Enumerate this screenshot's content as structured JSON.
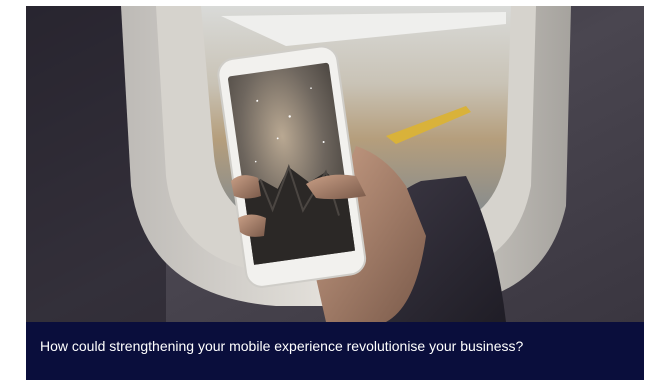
{
  "card": {
    "caption": "How could strengthening your mobile experience revolutionise your business?"
  },
  "image": {
    "subject": "hand holding smartphone in front of airplane window",
    "phone_screen": "night sky with mountains"
  },
  "colors": {
    "caption_background": "#0a0e3c",
    "caption_text": "#ffffff"
  }
}
